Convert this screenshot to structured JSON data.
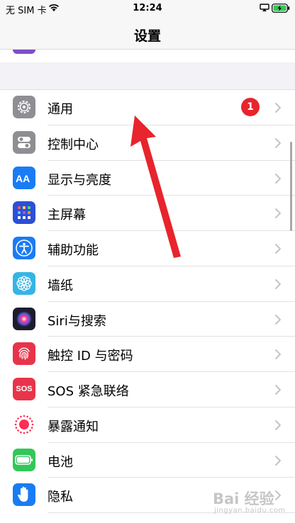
{
  "status_bar": {
    "carrier": "无 SIM 卡",
    "time": "12:24",
    "wifi_icon": "wifi-icon",
    "airplay_icon": "airplay-icon",
    "battery_icon": "battery-charging-icon"
  },
  "nav": {
    "title": "设置"
  },
  "settings": {
    "rows": [
      {
        "label": "通用",
        "icon": "gear-icon",
        "color": "#8e8e93",
        "badge": "1"
      },
      {
        "label": "控制中心",
        "icon": "toggles-icon",
        "color": "#8e8e93"
      },
      {
        "label": "显示与亮度",
        "icon": "text-size-icon",
        "color": "#1a7cf4"
      },
      {
        "label": "主屏幕",
        "icon": "app-grid-icon",
        "color": "#2c4fd8"
      },
      {
        "label": "辅助功能",
        "icon": "accessibility-icon",
        "color": "#1a7cf4"
      },
      {
        "label": "墙纸",
        "icon": "flower-icon",
        "color": "#35b5e5"
      },
      {
        "label": "Siri与搜索",
        "icon": "siri-icon",
        "color": "#1c1c2e"
      },
      {
        "label": "触控 ID 与密码",
        "icon": "fingerprint-icon",
        "color": "#e8344a"
      },
      {
        "label": "SOS 紧急联络",
        "icon": "sos-icon",
        "color": "#e8344a",
        "icon_text": "SOS"
      },
      {
        "label": "暴露通知",
        "icon": "exposure-notification-icon",
        "color": "#ffffff"
      },
      {
        "label": "电池",
        "icon": "battery-icon",
        "color": "#33c759"
      },
      {
        "label": "隐私",
        "icon": "hand-icon",
        "color": "#1a7cf4"
      }
    ]
  },
  "annotation": {
    "arrow_color": "#e8242c"
  },
  "watermark": {
    "logo": "Bai 经验",
    "url": "jingyan.baidu.com"
  }
}
